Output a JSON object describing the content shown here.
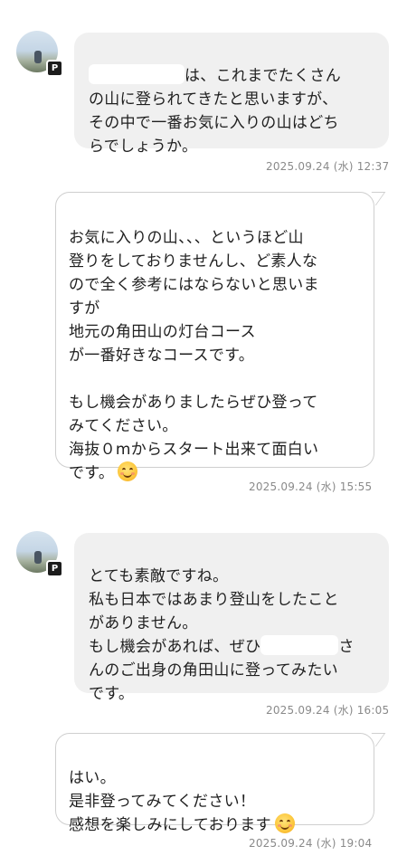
{
  "messages": [
    {
      "sender": "contact",
      "text_first_line_suffix": "は、これまでたくさん",
      "text_rest": "の山に登られてきたと思いますが、\nその中で一番お気に入りの山はどち\nらでしょうか。",
      "timestamp": "2025.09.24 (水) 12:37"
    },
    {
      "sender": "me",
      "text": "お気に入りの山、、、というほど山\n登りをしておりませんし、ど素人な\nので全く参考にはならないと思いま\nすが\n地元の角田山の灯台コース\nが一番好きなコースです。\n\nもし機会がありましたらぜひ登って\nみてください。\n海抜０mからスタート出来て面白い\nです。",
      "emoji": "smiling-face-icon",
      "timestamp": "2025.09.24 (水) 15:55"
    },
    {
      "sender": "contact",
      "text_lines_before": "とても素敵ですね。\n私も日本ではあまり登山をしたこと\nがありません。\nもし機会があれば、ぜひ",
      "text_after_mask": "さ",
      "text_rest": "んのご出身の角田山に登ってみたい\nです。",
      "timestamp": "2025.09.24 (水) 16:05"
    },
    {
      "sender": "me",
      "text": "はい。\n是非登ってみてください！\n感想を楽しみにしております",
      "emoji": "smiling-face-icon",
      "timestamp": "2025.09.24 (水) 19:04"
    }
  ],
  "avatar_badge": "P",
  "colors": {
    "incoming_bubble": "#f0f0f0",
    "outgoing_bubble": "#ffffff",
    "outgoing_border": "#cfcfcf",
    "timestamp": "#8a8a8a"
  }
}
